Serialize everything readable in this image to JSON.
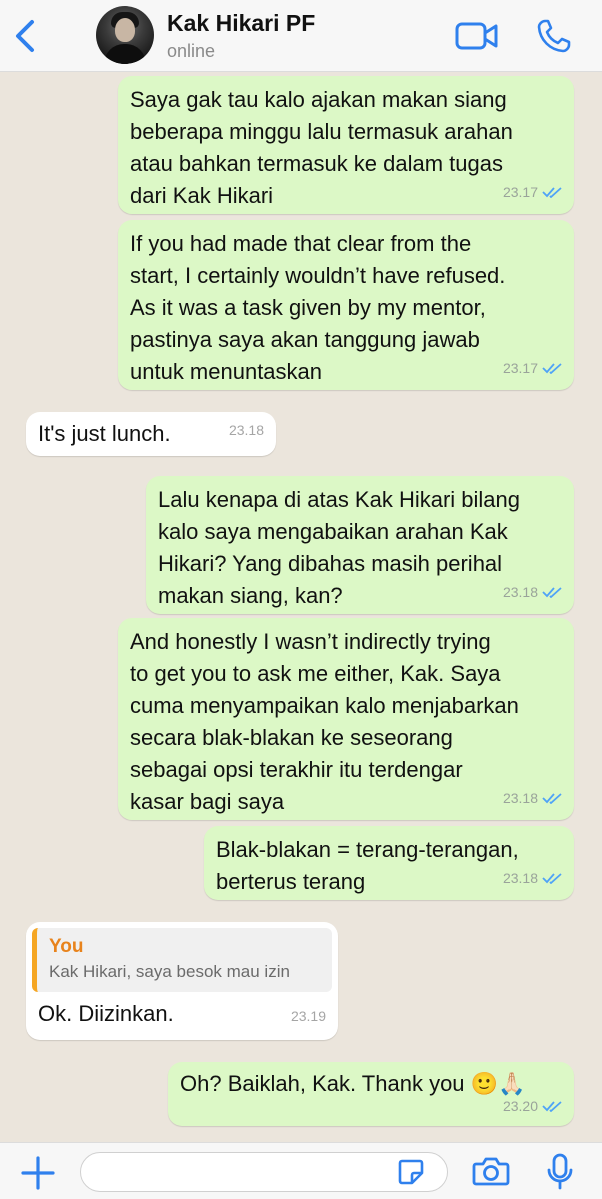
{
  "header": {
    "contact_name": "Kak Hikari PF",
    "status": "online"
  },
  "messages": [
    {
      "dir": "out",
      "text": "Saya gak tau kalo ajakan makan siang\nbeberapa minggu lalu termasuk arahan\natau bahkan termasuk ke dalam tugas\ndari Kak Hikari",
      "time": "23.17",
      "read": true
    },
    {
      "dir": "out",
      "text": "If you had made that clear from the\nstart, I certainly wouldn’t have refused.\nAs it was a task given by my mentor,\npastinya saya akan tanggung jawab\nuntuk menuntaskan",
      "time": "23.17",
      "read": true
    },
    {
      "dir": "in",
      "text": "It's just lunch.",
      "time": "23.18"
    },
    {
      "dir": "out",
      "text": "Lalu kenapa di atas Kak Hikari bilang\nkalo saya mengabaikan arahan Kak\nHikari? Yang dibahas masih perihal\nmakan siang, kan?",
      "time": "23.18",
      "read": true
    },
    {
      "dir": "out",
      "text": "And honestly I wasn’t indirectly trying\nto get you to ask me either, Kak. Saya\ncuma menyampaikan kalo menjabarkan\nsecara blak-blakan ke seseorang\nsebagai opsi terakhir itu terdengar\nkasar bagi saya",
      "time": "23.18",
      "read": true
    },
    {
      "dir": "out",
      "text": "Blak-blakan = terang-terangan,\nberterus terang",
      "time": "23.18",
      "read": true
    },
    {
      "dir": "in",
      "quote_author": "You",
      "quote_text": "Kak Hikari, saya besok mau izin",
      "text": "Ok. Diizinkan.",
      "time": "23.19"
    },
    {
      "dir": "out",
      "text": "Oh? Baiklah, Kak. Thank you 🙂🙏🏻",
      "time": "23.20",
      "read": true
    }
  ],
  "colors": {
    "accent": "#2f80ed",
    "outgoing_bubble": "#dcf8c6",
    "incoming_bubble": "#ffffff",
    "quote_author": "#e8831c",
    "read_ticks": "#4fa3f7"
  },
  "icons": {
    "back": "chevron-left-icon",
    "video": "video-camera-icon",
    "call": "phone-icon",
    "plus": "plus-icon",
    "sticker": "sticker-icon",
    "camera": "camera-icon",
    "mic": "microphone-icon"
  }
}
